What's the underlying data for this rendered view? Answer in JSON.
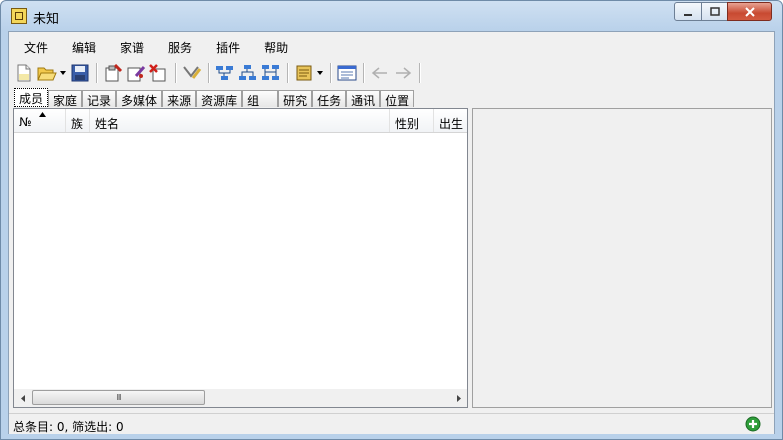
{
  "window": {
    "title": "未知"
  },
  "menu": [
    "文件",
    "编辑",
    "家谱",
    "服务",
    "插件",
    "帮助"
  ],
  "toolbar": {
    "icons": [
      "new-file-icon",
      "open-folder-icon",
      "save-icon",
      "add-person-icon",
      "edit-person-icon",
      "delete-person-icon",
      "filter-icon",
      "tree-icon",
      "tree-descendants-icon",
      "tree-ancestors-icon",
      "scroll-icon",
      "panel-view-icon",
      "back-arrow-icon",
      "forward-arrow-icon"
    ]
  },
  "tabs": [
    "成员",
    "家庭",
    "记录",
    "多媒体",
    "来源",
    "资源库",
    "组",
    "研究",
    "任务",
    "通讯",
    "位置"
  ],
  "table": {
    "columns": [
      "№",
      "族",
      "姓名",
      "性别",
      "出生"
    ],
    "scroll_thumb": "III"
  },
  "status": {
    "text": "总条目: 0, 筛选出: 0"
  },
  "colors": {
    "close_button": "#c84a32",
    "title_bar": "#b9d1ea"
  }
}
